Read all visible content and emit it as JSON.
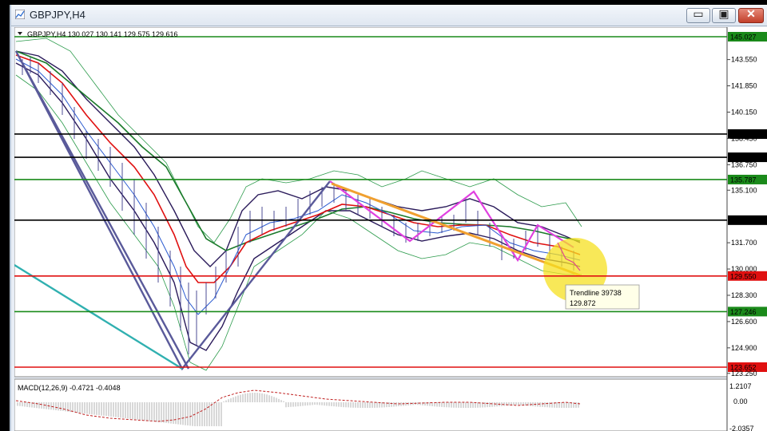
{
  "window": {
    "title": "GBPJPY,H4",
    "buttons": {
      "minimize": "▭",
      "maximize": "▣",
      "close": "✕"
    }
  },
  "chart": {
    "info_line": "GBPJPY,H4  130.027 130.141 129.575 129.616",
    "macd_label": "MACD(12,26,9) -0.4721 -0.4048",
    "trendline_label": "Trendline 39738",
    "trendline_value": "129.872"
  },
  "price_axis": {
    "ticks": [
      "143.550",
      "141.850",
      "140.150",
      "138.450",
      "136.750",
      "135.100",
      "131.700",
      "130.000",
      "128.300",
      "126.600",
      "124.900",
      "123.250"
    ],
    "macd_ticks": [
      "1.2107",
      "0.00",
      "-2.0357"
    ]
  },
  "levels": [
    {
      "value": "145.027",
      "color": "#1a8a1a"
    },
    {
      "value": "138.729",
      "color": "#000000"
    },
    {
      "value": "137.227",
      "color": "#000000"
    },
    {
      "value": "135.787",
      "color": "#1a8a1a"
    },
    {
      "value": "133.160",
      "color": "#000000"
    },
    {
      "value": "129.550",
      "color": "#e01010"
    },
    {
      "value": "127.246",
      "color": "#1a8a1a"
    },
    {
      "value": "123.652",
      "color": "#e01010"
    }
  ],
  "colors": {
    "background": "#ffffff",
    "magenta_pattern": "#e040e0",
    "orange_trend": "#f0a030",
    "teal_line": "#30b0b0",
    "zigzag": "#5a5a9a",
    "highlight": "#f5e020"
  }
}
